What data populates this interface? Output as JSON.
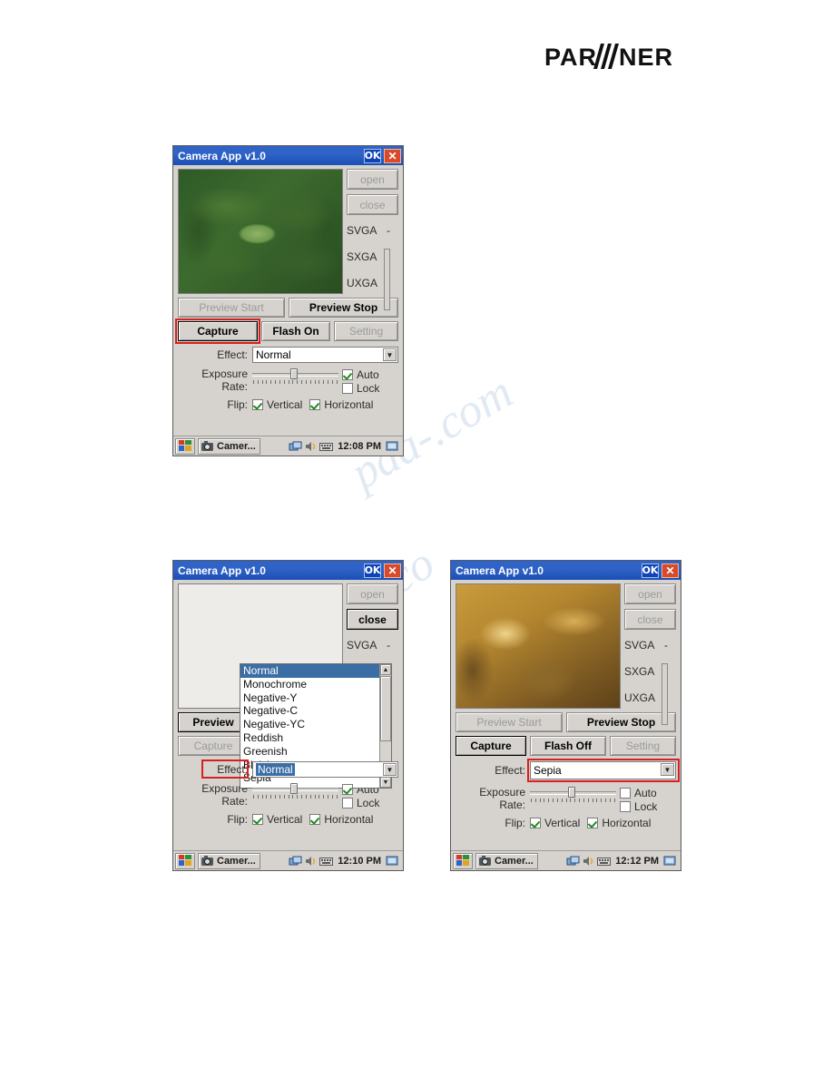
{
  "brand": {
    "name": "PARTNER"
  },
  "watermark": {
    "line1": "pda-.com",
    "line2": "archive.co"
  },
  "screens": [
    {
      "id": "screen-1",
      "title": "Camera App v1.0",
      "ok_label": "OK",
      "close_label": "✕",
      "preview_image": "plant-photo",
      "buttons": {
        "open": "open",
        "close": "close",
        "preview_start": "Preview Start",
        "preview_stop": "Preview Stop",
        "capture": "Capture",
        "flash": "Flash On",
        "setting": "Setting"
      },
      "resolutions": [
        "SVGA",
        "SXGA",
        "UXGA"
      ],
      "effect": {
        "label": "Effect:",
        "value": "Normal"
      },
      "exposure": {
        "label_line1": "Exposure",
        "label_line2": "Rate:"
      },
      "checks": {
        "auto": "Auto",
        "lock": "Lock"
      },
      "flip": {
        "label": "Flip:",
        "vertical": "Vertical",
        "horizontal": "Horizontal"
      },
      "taskbar": {
        "app": "Camer...",
        "clock": "12:08 PM"
      },
      "highlight": "capture-button"
    },
    {
      "id": "screen-2",
      "title": "Camera App v1.0",
      "ok_label": "OK",
      "close_label": "✕",
      "preview_image": "blank-gray",
      "buttons": {
        "open": "open",
        "close": "close",
        "preview_start": "Preview",
        "preview_stop": "",
        "capture": "Capture",
        "flash": "",
        "setting": ""
      },
      "resolutions": [
        "SVGA"
      ],
      "effect": {
        "label": "Effect:",
        "value": "Normal"
      },
      "dropdown_options": [
        "Normal",
        "Monochrome",
        "Negative-Y",
        "Negative-C",
        "Negative-YC",
        "Reddish",
        "Greenish",
        "Bluish",
        "Sepia"
      ],
      "dropdown_selected": "Normal",
      "exposure": {
        "label_line1": "Exposure",
        "label_line2": "Rate:"
      },
      "checks": {
        "auto": "Auto",
        "lock": "Lock"
      },
      "flip": {
        "label": "Flip:",
        "vertical": "Vertical",
        "horizontal": "Horizontal"
      },
      "taskbar": {
        "app": "Camer...",
        "clock": "12:10 PM"
      },
      "highlight": "effect-label"
    },
    {
      "id": "screen-3",
      "title": "Camera App v1.0",
      "ok_label": "OK",
      "close_label": "✕",
      "preview_image": "sepia-photo",
      "buttons": {
        "open": "open",
        "close": "close",
        "preview_start": "Preview Start",
        "preview_stop": "Preview Stop",
        "capture": "Capture",
        "flash": "Flash Off",
        "setting": "Setting"
      },
      "resolutions": [
        "SVGA",
        "SXGA",
        "UXGA"
      ],
      "effect": {
        "label": "Effect:",
        "value": "Sepia"
      },
      "exposure": {
        "label_line1": "Exposure",
        "label_line2": "Rate:"
      },
      "checks": {
        "auto": "Auto",
        "lock": "Lock"
      },
      "flip": {
        "label": "Flip:",
        "vertical": "Vertical",
        "horizontal": "Horizontal"
      },
      "taskbar": {
        "app": "Camer...",
        "clock": "12:12 PM"
      },
      "highlight": "effect-combo"
    }
  ],
  "colors": {
    "title_blue": "#2f63c8",
    "highlight_red": "#d81f1f",
    "check_green": "#1f8a1f",
    "face": "#d6d3ce"
  }
}
